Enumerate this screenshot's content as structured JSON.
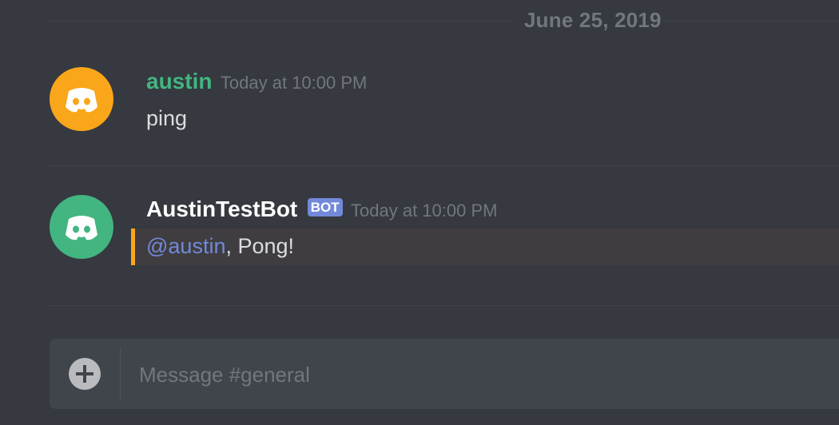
{
  "date_divider": {
    "label": "June 25, 2019"
  },
  "messages": [
    {
      "username": "austin",
      "username_color": "#43b581",
      "avatar_color": "#faa61a",
      "timestamp": "Today at 10:00 PM",
      "content": "ping"
    },
    {
      "username": "AustinTestBot",
      "username_color": "#ffffff",
      "avatar_color": "#43b581",
      "bot_tag": "BOT",
      "timestamp": "Today at 10:00 PM",
      "mention": "@austin",
      "content_rest": ", Pong!",
      "highlight_color": "#faa61a"
    }
  ],
  "composer": {
    "placeholder": "Message #general",
    "add_icon": "plus-circle-icon"
  },
  "colors": {
    "background": "#36393f",
    "input_background": "#40444b",
    "mention": "#7289da",
    "timestamp": "#72767d"
  }
}
